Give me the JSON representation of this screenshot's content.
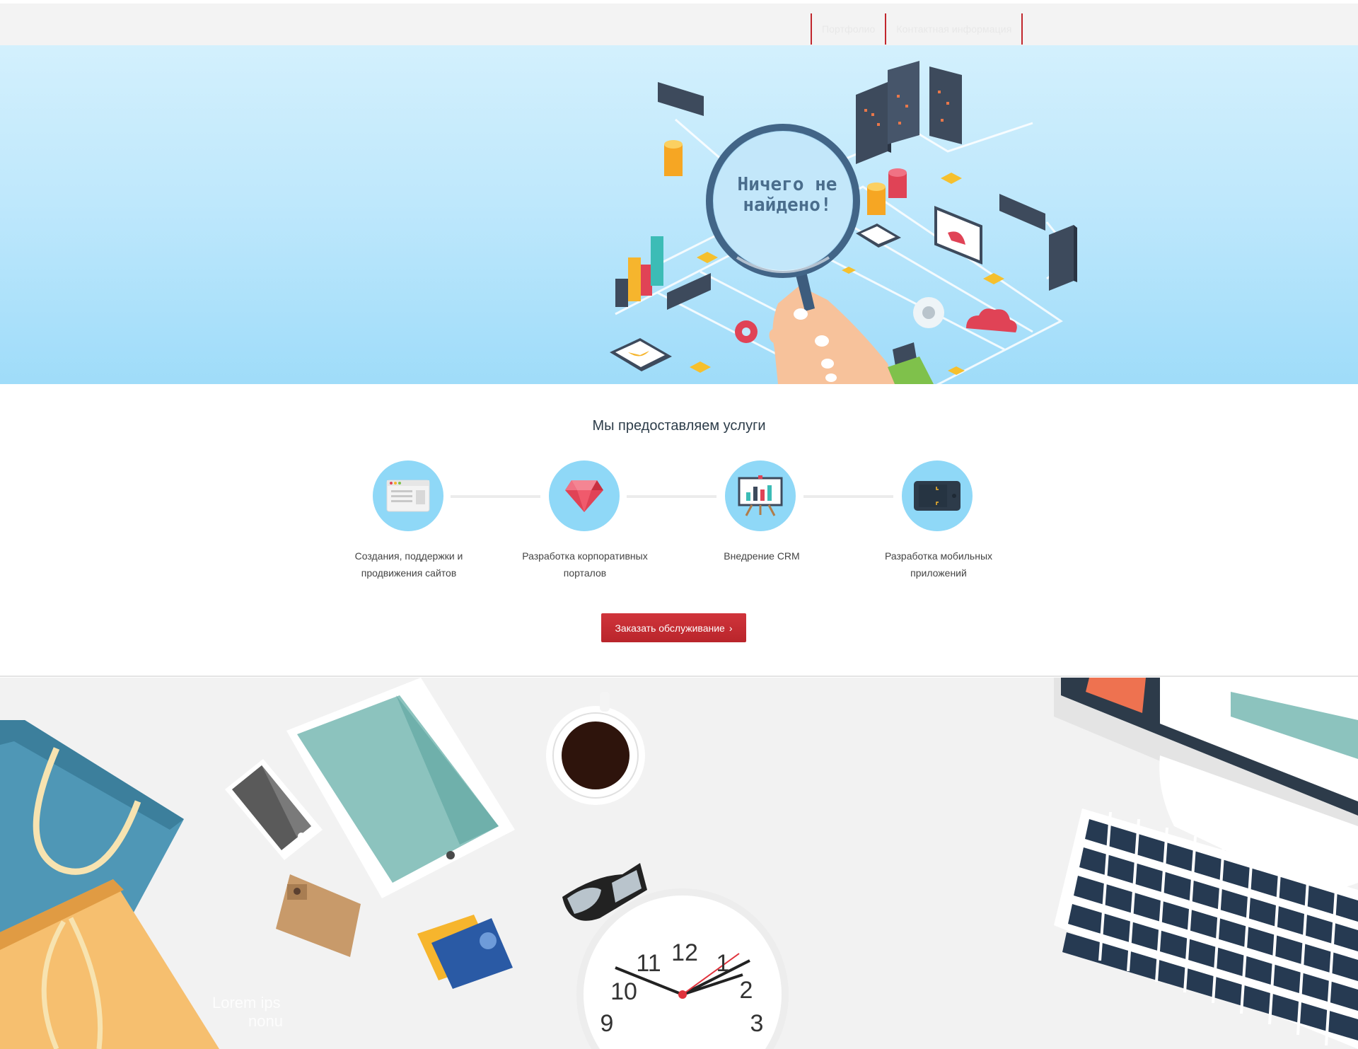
{
  "nav": {
    "items": [
      "Портфолио",
      "Контактная информация"
    ]
  },
  "hero": {
    "lens_text_line1": "Ничего не",
    "lens_text_line2": "найдено!"
  },
  "services": {
    "title": "Мы предоставляем услуги",
    "items": [
      {
        "label_line1": "Создания, поддержки и",
        "label_line2": "продвижения сайтов",
        "icon": "browser-window-icon"
      },
      {
        "label_line1": "Разработка корпоративных",
        "label_line2": "порталов",
        "icon": "ruby-gem-icon"
      },
      {
        "label_line1": "Внедрение CRM",
        "label_line2": "",
        "icon": "presentation-chart-icon"
      },
      {
        "label_line1": "Разработка мобильных",
        "label_line2": "приложений",
        "icon": "smartphone-icon"
      }
    ],
    "order_button": "Заказать обслуживание",
    "order_chevron": "›"
  },
  "desk": {
    "lorem_line1": "Lorem ips",
    "lorem_line2": "nonu",
    "clock_numbers": [
      "12",
      "1",
      "2",
      "3",
      "9",
      "10",
      "11"
    ]
  },
  "colors": {
    "accent": "#c1272d",
    "hero_top": "#d3f0fd",
    "hero_bottom": "#9fdcf9",
    "service_circle": "#8fd8f7"
  }
}
